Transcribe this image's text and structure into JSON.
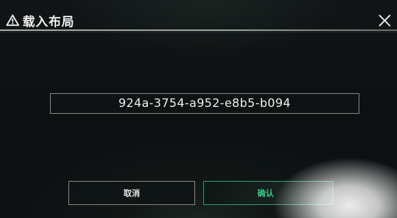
{
  "dialog": {
    "title": "载入布局",
    "title_icon": "warning-triangle-icon",
    "close_icon": "close-icon"
  },
  "code_field": {
    "value": "924a-3754-a952-e8b5-b094"
  },
  "buttons": {
    "cancel_label": "取消",
    "confirm_label": "确认"
  },
  "colors": {
    "background": "#0b0e0f",
    "border": "#8c9290",
    "accent": "#36c98d"
  }
}
